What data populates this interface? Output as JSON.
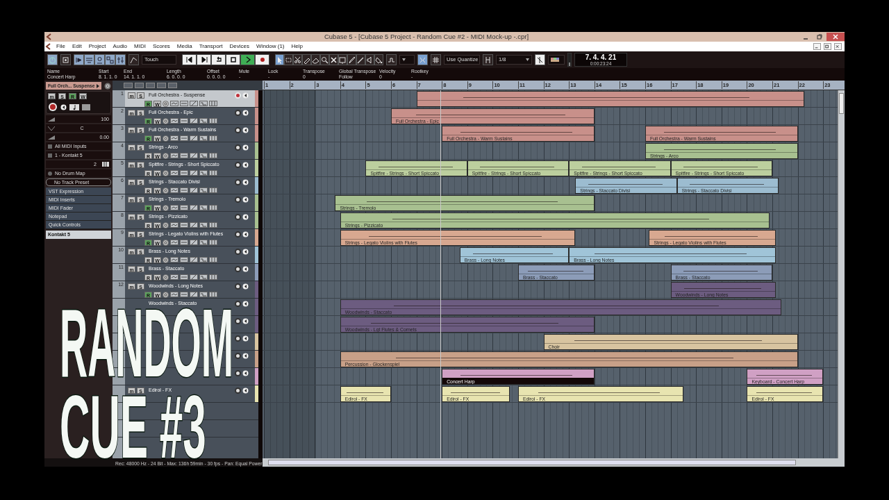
{
  "window": {
    "title": "Cubase 5 - [Cubase 5 Project - Random Cue #2 - MIDI Mock-up -.cpr]"
  },
  "menu": [
    "File",
    "Edit",
    "Project",
    "Audio",
    "MIDI",
    "Scores",
    "Media",
    "Transport",
    "Devices",
    "Window (1)",
    "Help"
  ],
  "toolbar": {
    "view_toggles": [
      {
        "on": true
      },
      {
        "on": true
      },
      {
        "on": true
      },
      {
        "on": true
      },
      {
        "on": true
      }
    ],
    "automation_mode": "Touch",
    "playing": true,
    "tools": [
      {
        "kind": "arrow",
        "selected": true
      },
      {
        "kind": "range",
        "selected": false
      },
      {
        "kind": "split",
        "selected": false
      },
      {
        "kind": "glue",
        "selected": false
      },
      {
        "kind": "eraser",
        "selected": false
      },
      {
        "kind": "zoom",
        "selected": false
      },
      {
        "kind": "mute",
        "selected": false
      },
      {
        "kind": "warp",
        "selected": false
      },
      {
        "kind": "pencil",
        "selected": false
      },
      {
        "kind": "line",
        "selected": false
      },
      {
        "kind": "play",
        "selected": false
      },
      {
        "kind": "color",
        "selected": false
      }
    ],
    "snap_type": "Use Quantize",
    "quantize": "1/8",
    "position": "7. 4. 4. 21",
    "time": "0:00:23:24"
  },
  "info_line": [
    {
      "label": "Name",
      "value": "Concert Harp"
    },
    {
      "label": "Start",
      "value": "8. 1. 1. 0"
    },
    {
      "label": "End",
      "value": "14. 1. 1. 0"
    },
    {
      "label": "Length",
      "value": "6. 0. 0. 0"
    },
    {
      "label": "Offset",
      "value": "0. 0. 0. 0"
    },
    {
      "label": "Mute",
      "value": "-"
    },
    {
      "label": "Lock",
      "value": "-"
    },
    {
      "label": "Transpose",
      "value": "0"
    },
    {
      "label": "Global Transpose",
      "value": "Follow"
    },
    {
      "label": "Velocity",
      "value": "0"
    },
    {
      "label": "Rootkey",
      "value": "-"
    }
  ],
  "inspector": {
    "track_title": "Full Orch... Suspense",
    "buttons": [
      "m",
      "S",
      "R",
      "W"
    ],
    "volume": "100",
    "pan": "C",
    "delay": "0.00",
    "input": "All MIDI Inputs",
    "output": "1 - Kontakt 5",
    "channel": "2",
    "drum_map": "No Drum Map",
    "preset": "No Track Preset",
    "sections": [
      "VST Expression",
      "MIDI Inserts",
      "MIDI Fader",
      "Notepad",
      "Quick Controls"
    ],
    "instrument": "Kontakt 5"
  },
  "ruler": [
    "1",
    "2",
    "3",
    "4",
    "5",
    "6",
    "7",
    "8",
    "9",
    "10",
    "11",
    "12",
    "13",
    "14",
    "15",
    "16",
    "17",
    "18",
    "19",
    "20",
    "21",
    "22",
    "23"
  ],
  "tracks": [
    {
      "number": "1",
      "name": "Full Orchestra - Suspense",
      "buttons": [
        "m",
        "S",
        "R",
        "W"
      ],
      "selected": true,
      "armed": true,
      "read": true,
      "color": "#c8908a",
      "parts": [
        {
          "selected": false
        }
      ]
    },
    {
      "number": "2",
      "name": "Full Orchestra - Epic",
      "buttons": [
        "m",
        "S",
        "R",
        "W"
      ],
      "selected": false,
      "armed": false,
      "read": true,
      "color": "#c8908a",
      "parts": [
        {
          "name": "Full Orchestra - Epic",
          "selected": false
        }
      ]
    },
    {
      "number": "3",
      "name": "Full Orchestra - Warm Sustains",
      "buttons": [
        "m",
        "S",
        "R",
        "W"
      ],
      "selected": false,
      "armed": false,
      "read": true,
      "color": "#c8908a",
      "parts": [
        {
          "name": "Full Orchestra - Warm Sustains",
          "selected": false
        },
        {
          "name": "Full Orchestra - Warm Sustains",
          "selected": false
        }
      ]
    },
    {
      "number": "4",
      "name": "Strings - Arco",
      "buttons": [
        "m",
        "S",
        "R",
        "W"
      ],
      "selected": false,
      "armed": false,
      "read": false,
      "color": "#a8c090",
      "parts": [
        {
          "name": "Strings - Arco",
          "selected": false
        }
      ]
    },
    {
      "number": "5",
      "name": "Spitfire - Strings - Short Spiccato",
      "buttons": [
        "m",
        "S",
        "R",
        "W"
      ],
      "selected": false,
      "armed": false,
      "read": false,
      "color": "#bccf9e",
      "parts": [
        {
          "name": "Spitfire - Strings - Short Spiccato",
          "selected": false
        },
        {
          "name": "Spitfire - Strings - Short Spiccato",
          "selected": false
        },
        {
          "name": "Spitfire - Strings - Short Spiccato",
          "selected": false
        },
        {
          "name": "Spitfire - Strings - Short Spiccato",
          "selected": false
        }
      ]
    },
    {
      "number": "6",
      "name": "Strings - Staccato Divisi",
      "buttons": [
        "m",
        "S",
        "R",
        "W"
      ],
      "selected": false,
      "armed": false,
      "read": false,
      "color": "#9cbcd0",
      "parts": [
        {
          "name": "Strings - Staccato Divisi",
          "selected": false
        },
        {
          "name": "Strings - Staccato Divisi",
          "selected": false
        }
      ]
    },
    {
      "number": "7",
      "name": "Strings - Tremolo",
      "buttons": [
        "m",
        "S",
        "R",
        "W"
      ],
      "selected": false,
      "armed": false,
      "read": true,
      "color": "#a8c090",
      "parts": [
        {
          "name": "Strings - Tremolo",
          "selected": false
        }
      ]
    },
    {
      "number": "8",
      "name": "Strings - Pizzicato",
      "buttons": [
        "m",
        "S",
        "R",
        "W"
      ],
      "selected": false,
      "armed": false,
      "read": false,
      "color": "#a8c090",
      "parts": [
        {
          "name": "Strings - Pizzicato",
          "selected": false
        }
      ]
    },
    {
      "number": "9",
      "name": "Strings - Legato Violins with Flutes",
      "buttons": [
        "m",
        "S",
        "R",
        "W"
      ],
      "selected": false,
      "armed": false,
      "read": true,
      "color": "#d8a890",
      "parts": [
        {
          "name": "Strings - Legato Violins with Flutes",
          "selected": false
        },
        {
          "name": "Strings - Legato Violins with Flutes",
          "selected": false
        }
      ]
    },
    {
      "number": "10",
      "name": "Brass - Long Notes",
      "buttons": [
        "m",
        "S",
        "R",
        "W"
      ],
      "selected": false,
      "armed": false,
      "read": false,
      "color": "#a0c4d8",
      "parts": [
        {
          "name": "Brass - Long Notes",
          "selected": false
        },
        {
          "name": "Brass - Long Notes",
          "selected": false
        }
      ]
    },
    {
      "number": "11",
      "name": "Brass - Staccato",
      "buttons": [
        "m",
        "S",
        "R",
        "W"
      ],
      "selected": false,
      "armed": false,
      "read": false,
      "color": "#8c9cb8",
      "parts": [
        {
          "name": "Brass - Staccato",
          "selected": false
        },
        {
          "name": "Brass - Staccato",
          "selected": false
        }
      ]
    },
    {
      "number": "12",
      "name": "Woodwinds - Long Notes",
      "buttons": [
        "m",
        "S",
        "R",
        "W"
      ],
      "selected": false,
      "armed": false,
      "read": true,
      "color": "#6c5c80",
      "parts": [
        {
          "name": "Woodwinds - Long Notes",
          "selected": false
        }
      ]
    },
    {
      "name": "Woodwinds - Staccato",
      "selected": false,
      "armed": false,
      "color": "#6c5c80",
      "parts": [
        {
          "name": "Woodwinds - Staccato",
          "selected": false
        }
      ]
    },
    {
      "selected": false,
      "armed": false,
      "color": "#6c5c80",
      "parts": [
        {
          "name": "Woodwinds - Lgt Flutes & Cornets",
          "selected": false
        }
      ]
    },
    {
      "selected": false,
      "armed": false,
      "color": "#d8c4a0",
      "parts": [
        {
          "name": "Choir",
          "selected": false
        }
      ]
    },
    {
      "selected": false,
      "armed": false,
      "color": "#c8a088",
      "parts": [
        {
          "name": "Percussion - Glockenspiel",
          "selected": false
        }
      ]
    },
    {
      "selected": false,
      "armed": false,
      "color": "#d0a0c4",
      "parts": [
        {
          "name": "Concert Harp",
          "selected": true
        },
        {
          "name": "Keyboard - Concert Harp",
          "selected": false
        }
      ]
    },
    {
      "name": "Edirol - FX",
      "buttons": [
        "m",
        "S"
      ],
      "selected": false,
      "armed": false,
      "color": "#e8e4b0",
      "parts": [
        {
          "name": "Edirol - FX",
          "selected": false
        },
        {
          "name": "Edirol - FX",
          "selected": false
        },
        {
          "name": "Edirol - FX",
          "selected": false
        },
        {
          "name": "Edirol - FX",
          "selected": false
        }
      ]
    }
  ],
  "status_bar": "Rec: 48000 Hz - 24 Bit - Max: 136h 59min - 30 fps - Pan: Equal Power",
  "overlay_title": [
    "RANDOM",
    "CUE #3"
  ]
}
